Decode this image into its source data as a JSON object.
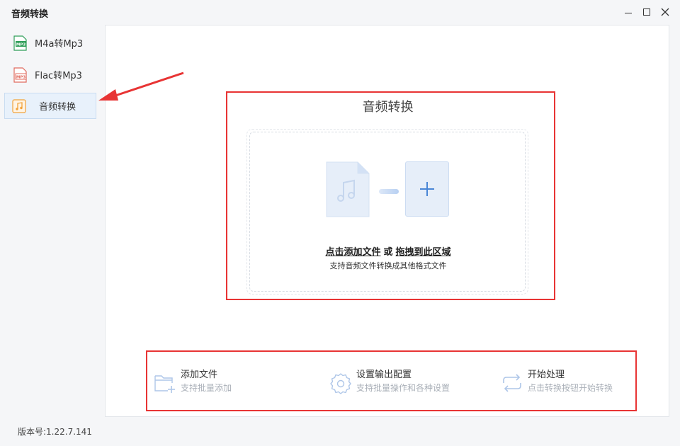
{
  "window": {
    "title": "音频转换",
    "controls": [
      "minimize-icon",
      "maximize-icon",
      "close-icon"
    ]
  },
  "sidebar": {
    "items": [
      {
        "label": "M4a转Mp3",
        "icon": "mp3-file-icon",
        "icon_color": "#2e9e58",
        "active": false
      },
      {
        "label": "Flac转Mp3",
        "icon": "mp3-file-icon",
        "icon_color": "#e06a5e",
        "active": false
      },
      {
        "label": "音频转换",
        "icon": "music-note-icon",
        "icon_color": "#f2a23a",
        "active": true
      }
    ]
  },
  "main": {
    "title": "音频转换",
    "dropzone": {
      "add_link": "点击添加文件",
      "or": "或",
      "drag_link": "拖拽到此区域",
      "hint": "支持音频文件转换成其他格式文件"
    },
    "steps": [
      {
        "title": "添加文件",
        "subtitle": "支持批量添加",
        "icon": "folder-add-icon"
      },
      {
        "title": "设置输出配置",
        "subtitle": "支持批量操作和各种设置",
        "icon": "gear-icon"
      },
      {
        "title": "开始处理",
        "subtitle": "点击转换按钮开始转换",
        "icon": "repeat-icon"
      }
    ]
  },
  "footer": {
    "version": "版本号:1.22.7.141"
  },
  "colors": {
    "accent": "#4a86d6",
    "annotation": "#e83434",
    "active_bg": "#e8f1fb"
  }
}
